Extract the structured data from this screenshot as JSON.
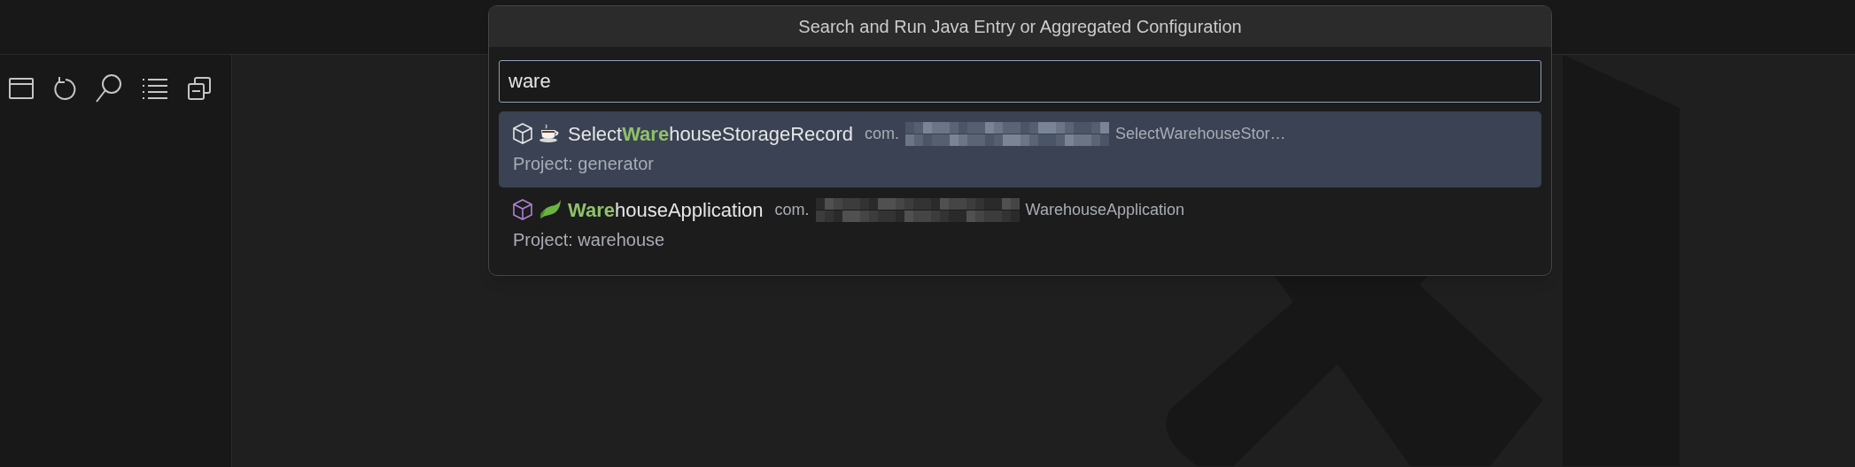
{
  "toolbar": {
    "icons": [
      {
        "kind": "window"
      },
      {
        "kind": "refresh"
      },
      {
        "kind": "search"
      },
      {
        "kind": "list"
      },
      {
        "kind": "collapse"
      }
    ]
  },
  "quick_pick": {
    "title": "Search and Run Java Entry or Aggregated Configuration",
    "input": {
      "value": "ware"
    },
    "items": [
      {
        "kind": "coffee",
        "color": "#e6e6e6",
        "label": "Select**Ware**houseStorageRecord",
        "description_prefix": "com.",
        "description_suffix": "SelectWarehouseStor…",
        "detail": "Project: generator",
        "selected": true
      },
      {
        "kind": "leaf",
        "color": "#b180d7",
        "label": "**Ware**houseApplication",
        "description_prefix": "com.",
        "description_suffix": "WarehouseApplication",
        "detail": "Project: warehouse",
        "selected": false
      }
    ]
  }
}
